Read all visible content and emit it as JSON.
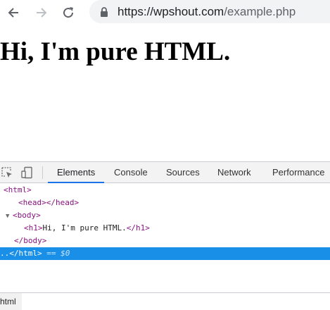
{
  "browser": {
    "url_host": "https://wpshout.com",
    "url_path": "/example.php",
    "icons": [
      "back-icon",
      "forward-icon",
      "reload-icon",
      "lock-icon"
    ]
  },
  "page": {
    "heading": "Hi, I'm pure HTML."
  },
  "devtools": {
    "tabs": [
      "Elements",
      "Console",
      "Sources",
      "Network",
      "Performance"
    ],
    "active_tab": "Elements",
    "dom": {
      "html_open": "<html>",
      "head_open": "<head>",
      "head_close": "</head>",
      "body_open": "<body>",
      "h1_open": "<h1>",
      "h1_text": "Hi, I'm pure HTML.",
      "h1_close": "</h1>",
      "body_close": "</body>",
      "html_close": "</html>",
      "selected_prefix": "..",
      "selected_marker": "== $0"
    },
    "breadcrumb": "html",
    "accent_color": "#1a73e8",
    "selection_color": "#1a8fe8"
  }
}
